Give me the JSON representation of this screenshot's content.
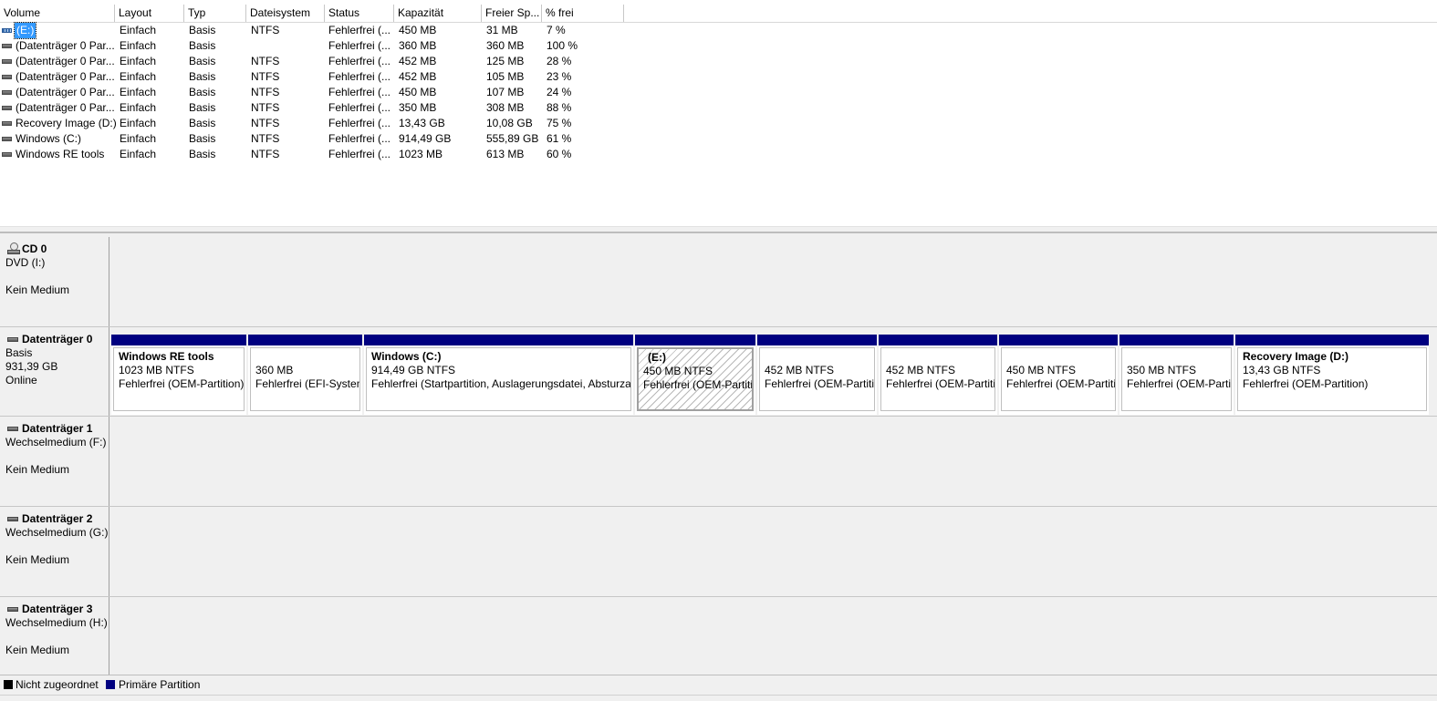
{
  "volume_list": {
    "columns": [
      "Volume",
      "Layout",
      "Typ",
      "Dateisystem",
      "Status",
      "Kapazität",
      "Freier Sp...",
      "% frei"
    ],
    "rows": [
      {
        "name": "(E:)",
        "layout": "Einfach",
        "typ": "Basis",
        "fs": "NTFS",
        "status": "Fehlerfrei (...",
        "cap": "450 MB",
        "free": "31 MB",
        "pct": "7 %"
      },
      {
        "name": "(Datenträger 0 Par...",
        "layout": "Einfach",
        "typ": "Basis",
        "fs": "",
        "status": "Fehlerfrei (...",
        "cap": "360 MB",
        "free": "360 MB",
        "pct": "100 %"
      },
      {
        "name": "(Datenträger 0 Par...",
        "layout": "Einfach",
        "typ": "Basis",
        "fs": "NTFS",
        "status": "Fehlerfrei (...",
        "cap": "452 MB",
        "free": "125 MB",
        "pct": "28 %"
      },
      {
        "name": "(Datenträger 0 Par...",
        "layout": "Einfach",
        "typ": "Basis",
        "fs": "NTFS",
        "status": "Fehlerfrei (...",
        "cap": "452 MB",
        "free": "105 MB",
        "pct": "23 %"
      },
      {
        "name": "(Datenträger 0 Par...",
        "layout": "Einfach",
        "typ": "Basis",
        "fs": "NTFS",
        "status": "Fehlerfrei (...",
        "cap": "450 MB",
        "free": "107 MB",
        "pct": "24 %"
      },
      {
        "name": "(Datenträger 0 Par...",
        "layout": "Einfach",
        "typ": "Basis",
        "fs": "NTFS",
        "status": "Fehlerfrei (...",
        "cap": "350 MB",
        "free": "308 MB",
        "pct": "88 %"
      },
      {
        "name": "Recovery Image (D:)",
        "layout": "Einfach",
        "typ": "Basis",
        "fs": "NTFS",
        "status": "Fehlerfrei (...",
        "cap": "13,43 GB",
        "free": "10,08 GB",
        "pct": "75 %"
      },
      {
        "name": "Windows (C:)",
        "layout": "Einfach",
        "typ": "Basis",
        "fs": "NTFS",
        "status": "Fehlerfrei (...",
        "cap": "914,49 GB",
        "free": "555,89 GB",
        "pct": "61 %"
      },
      {
        "name": "Windows RE tools",
        "layout": "Einfach",
        "typ": "Basis",
        "fs": "NTFS",
        "status": "Fehlerfrei (...",
        "cap": "1023 MB",
        "free": "613 MB",
        "pct": "60 %"
      }
    ]
  },
  "disks": {
    "cd0": {
      "title": "CD 0",
      "line1": "DVD (I:)",
      "line3": "Kein Medium"
    },
    "disk0": {
      "title": "Datenträger 0",
      "line1": "Basis",
      "line2": "931,39 GB",
      "line3": "Online",
      "partitions": [
        {
          "name": "Windows RE tools",
          "size": "1023 MB NTFS",
          "status": "Fehlerfrei (OEM-Partition)"
        },
        {
          "name": "",
          "size": "360 MB",
          "status": "Fehlerfrei (EFI-Systempartition)"
        },
        {
          "name": "Windows  (C:)",
          "size": "914,49 GB NTFS",
          "status": "Fehlerfrei (Startpartition, Auslagerungsdatei, Absturzabbild, Primäre Partition)"
        },
        {
          "name": "(E:)",
          "size": "450 MB NTFS",
          "status": "Fehlerfrei (OEM-Partition)"
        },
        {
          "name": "",
          "size": "452 MB NTFS",
          "status": "Fehlerfrei (OEM-Partition)"
        },
        {
          "name": "",
          "size": "452 MB NTFS",
          "status": "Fehlerfrei (OEM-Partition)"
        },
        {
          "name": "",
          "size": "450 MB NTFS",
          "status": "Fehlerfrei (OEM-Partition)"
        },
        {
          "name": "",
          "size": "350 MB NTFS",
          "status": "Fehlerfrei (OEM-Partition)"
        },
        {
          "name": "Recovery Image  (D:)",
          "size": "13,43 GB NTFS",
          "status": "Fehlerfrei (OEM-Partition)"
        }
      ]
    },
    "disk1": {
      "title": "Datenträger 1",
      "line1": "Wechselmedium (F:)",
      "line3": "Kein Medium"
    },
    "disk2": {
      "title": "Datenträger 2",
      "line1": "Wechselmedium (G:)",
      "line3": "Kein Medium"
    },
    "disk3": {
      "title": "Datenträger 3",
      "line1": "Wechselmedium (H:)",
      "line3": "Kein Medium"
    }
  },
  "legend": {
    "unallocated": "Nicht zugeordnet",
    "primary": "Primäre Partition",
    "unallocated_color": "#000000",
    "primary_color": "#000080"
  },
  "icons": {
    "volume": "drive-icon",
    "cd": "cd-drive-icon",
    "disk": "hard-disk-icon"
  }
}
